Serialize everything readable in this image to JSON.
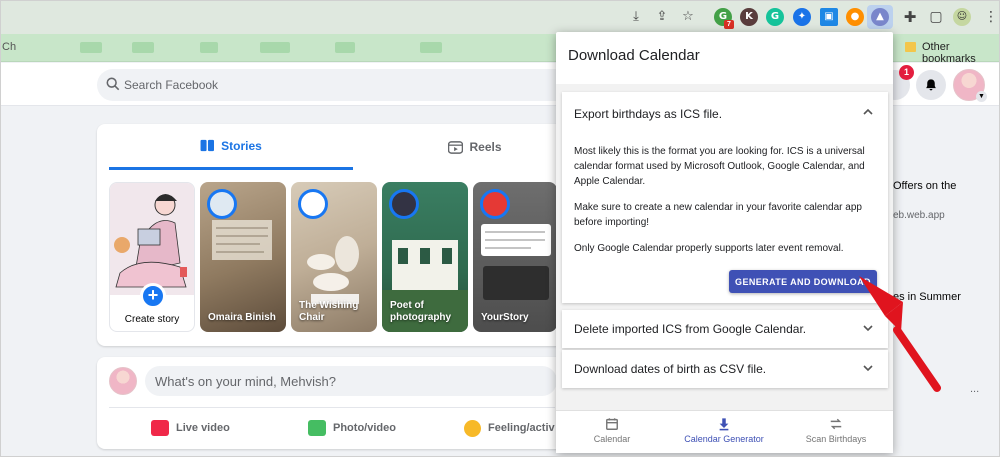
{
  "facebook": {
    "search": {
      "placeholder": "Search Facebook"
    },
    "notifications": {
      "badge": "1"
    },
    "tabs": [
      {
        "label": "Stories",
        "active": true,
        "icon": "book-icon"
      },
      {
        "label": "Reels",
        "active": false,
        "icon": "reels-icon"
      }
    ],
    "stories": [
      {
        "label": "Create story"
      },
      {
        "name": "Omaira Binish"
      },
      {
        "name": "The Wishing Chair"
      },
      {
        "name": "Poet of photography"
      },
      {
        "name": "YourStory"
      }
    ],
    "composer": {
      "placeholder": "What's on your mind, Mehvish?",
      "actions": [
        {
          "label": "Live video",
          "color": "#f02849"
        },
        {
          "label": "Photo/video",
          "color": "#45bd62"
        },
        {
          "label": "Feeling/activ",
          "color": "#f7b928"
        }
      ]
    },
    "sidebar": {
      "offer_text": "Offers on the",
      "offer_sub": "eb.web.app",
      "summer_text": "es in Summer",
      "more": "..."
    }
  },
  "browser": {
    "bookmarks_left": "Ch",
    "other_bookmarks": "Other bookmarks",
    "ext_badge": "7"
  },
  "popup": {
    "title": "Download Calendar",
    "panels": [
      {
        "title": "Export birthdays as ICS file.",
        "expanded": true,
        "paragraphs": [
          "Most likely this is the format you are looking for. ICS is a universal calendar format used by Microsoft Outlook, Google Calendar, and Apple Calendar.",
          "Make sure to create a new calendar in your favorite calendar app before importing!",
          "Only Google Calendar properly supports later event removal."
        ],
        "button": "GENERATE AND DOWNLOAD"
      },
      {
        "title": "Delete imported ICS from Google Calendar.",
        "expanded": false
      },
      {
        "title": "Download dates of birth as CSV file.",
        "expanded": false
      }
    ],
    "nav": [
      {
        "label": "Calendar",
        "icon": "calendar-icon",
        "active": false
      },
      {
        "label": "Calendar Generator",
        "icon": "download-icon",
        "active": true
      },
      {
        "label": "Scan Birthdays",
        "icon": "sync-icon",
        "active": false
      }
    ]
  },
  "colors": {
    "accent": "#3f51b5",
    "fb_blue": "#1877f2",
    "annotation": "#e0141e"
  }
}
